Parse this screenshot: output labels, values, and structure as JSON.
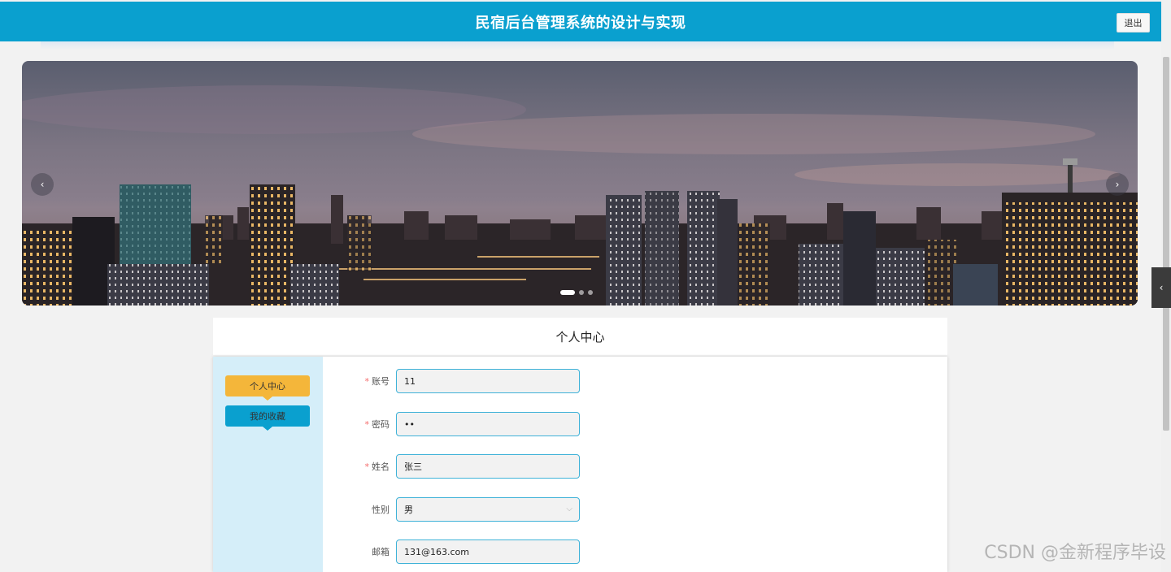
{
  "header": {
    "title": "民宿后台管理系统的设计与实现",
    "logout_label": "退出"
  },
  "banner": {
    "prev_icon": "‹",
    "next_icon": "›",
    "slide_count": 3,
    "active_index": 0
  },
  "side_toggle_icon": "‹",
  "section": {
    "title": "个人中心"
  },
  "menu": {
    "items": [
      {
        "label": "个人中心"
      },
      {
        "label": "我的收藏"
      }
    ]
  },
  "form": {
    "fields": [
      {
        "label": "账号",
        "required": true,
        "value": "11"
      },
      {
        "label": "密码",
        "required": true,
        "value": "••"
      },
      {
        "label": "姓名",
        "required": true,
        "value": "张三"
      },
      {
        "label": "性别",
        "required": false,
        "value": "男"
      },
      {
        "label": "邮箱",
        "required": false,
        "value": "131@163.com"
      }
    ],
    "required_mark": "*",
    "select_chevron": "⌵"
  },
  "watermark": "CSDN @金新程序毕设",
  "colors": {
    "header": "#0aa0cf",
    "menu_active": "#f4b63a",
    "menu_secondary": "#0aa0cf",
    "sidebar_bg": "#d5eef9",
    "input_border": "#3fb2d8"
  }
}
